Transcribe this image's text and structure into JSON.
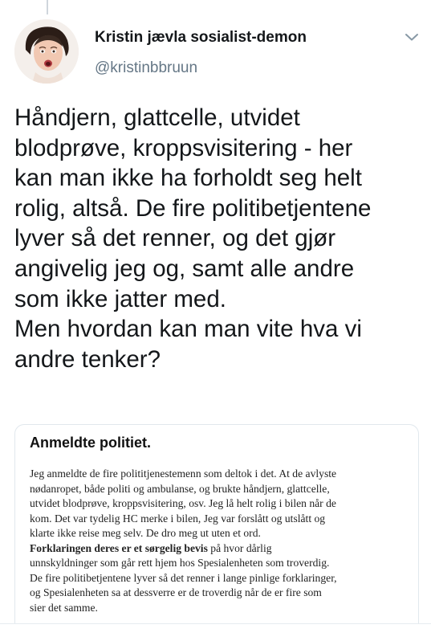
{
  "tweet": {
    "author": {
      "display_name": "Kristin jævla sosialist-demon",
      "handle": "@kristinbbruun"
    },
    "text_lines": [
      "Håndjern, glattcelle, utvidet",
      "blodprøve, kroppsvisitering - her",
      "kan man ikke ha forholdt seg helt",
      "rolig, altså. De fire politibetjentene",
      "lyver så det renner, og det gjør",
      "angivelig jeg og, samt alle andre",
      "som ikke jatter med.",
      "Men hvordan kan man vite hva vi",
      "andre tenker?"
    ],
    "menu_icon": "chevron-down-icon"
  },
  "attached_image": {
    "title": "Anmeldte politiet.",
    "lines": [
      "Jeg anmeldte de fire polititjenestemenn som deltok i det. At de avlyste",
      "nødanropet, både politi og ambulanse, og brukte håndjern, glattcelle,",
      "utvidet blodprøve, kroppsvisitering, osv. Jeg lå helt rolig i bilen når de",
      "kom. Det var tydelig HC merke i bilen, Jeg var forslått og utslått og",
      "klarte ikke reise meg selv. De dro meg ut uten et ord.",
      "på hvor dårlig",
      "unnskyldninger som går rett hjem hos Spesialenheten som troverdig.",
      "De fire politibetjentene lyver så det renner i lange pinlige forklaringer,",
      "og Spesialenheten sa at dessverre er de troverdig når de er fire som",
      "sier det samme."
    ],
    "bold_lead": "Forklaringen deres er et sørgelig bevis"
  },
  "colors": {
    "text": "#14171a",
    "secondary": "#657786",
    "border": "#e1e8ed"
  }
}
